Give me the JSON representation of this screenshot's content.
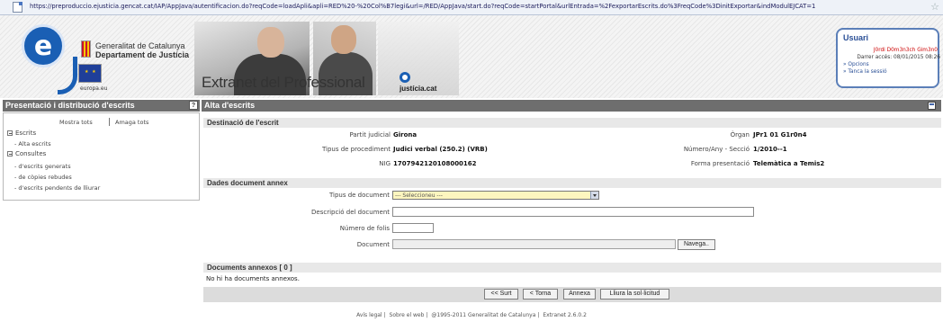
{
  "browser": {
    "url": "https://preproduccio.ejusticia.gencat.cat/IAP/AppJava/autentificacion.do?reqCode=loadApli&apli=RED%20-%20Col%B7legi&url=/RED/AppJava/start.do?reqCode=startPortal&urlEntrada=%2FexportarEscrits.do%3FreqCode%3DinitExportar&indModulEJCAT=1"
  },
  "header": {
    "brand_letter": "e",
    "generalitat_line1": "Generalitat de Catalunya",
    "generalitat_line2": "Departament de Justícia",
    "eu_label": "europa.eu",
    "extranet_title": "Extranet del Professional",
    "justicia_label": "justícia.cat"
  },
  "user": {
    "title": "Usuari",
    "name": "J0rdi D0m3n3ch Gim3n0",
    "last_access": "Darrer accés: 08/01/2015 08:26",
    "options": "» Opcions",
    "logout": "» Tanca la sessió"
  },
  "sidebar": {
    "heading": "Presentació i distribució d'escrits",
    "help": "?",
    "show_all": "Mostra tots",
    "hide_all": "Amaga tots",
    "escrits": "Escrits",
    "alta_escrits": "- Alta escrits",
    "consultes": "Consultes",
    "consulta_generats": "- d'escrits generats",
    "consulta_copies": "- de còpies rebudes",
    "consulta_pendents": "- d'escrits pendents de lliurar"
  },
  "main": {
    "heading": "Alta d'escrits",
    "section_desti": "Destinació de l'escrit",
    "partit_label": "Partit judicial",
    "partit_value": "Girona",
    "organ_label": "Òrgan",
    "organ_value": "JPr1 01 G1r0n4",
    "procediment_label": "Tipus de procediment",
    "procediment_value": "Judici verbal (250.2) (VRB)",
    "numero_label": "Número/Any - Secció",
    "numero_value": "1/2010--1",
    "nig_label": "NIG",
    "nig_value": "1707942120108000162",
    "forma_label": "Forma presentació",
    "forma_value": "Telemàtica a Temis2",
    "section_dades": "Dades document annex",
    "tipus_label": "Tipus de document",
    "tipus_selected": "--- Seleccioneu ---",
    "descripcio_label": "Descripció del document",
    "folis_label": "Número de folis",
    "document_label": "Document",
    "browse_button": "Navega..",
    "section_annexos": "Documents annexos [ 0 ]",
    "no_docs": "No hi ha documents annexos.",
    "btn_surt": "<< Surt",
    "btn_torna": "< Torna",
    "btn_annexa": "Annexa",
    "btn_lliura": "Lliura la sol·licitud"
  },
  "footer": {
    "legal": "Avís legal",
    "about": "Sobre el web",
    "copyright": "@1995-2011 Generalitat de Catalunya",
    "version": "Extranet 2.6.0.2"
  }
}
